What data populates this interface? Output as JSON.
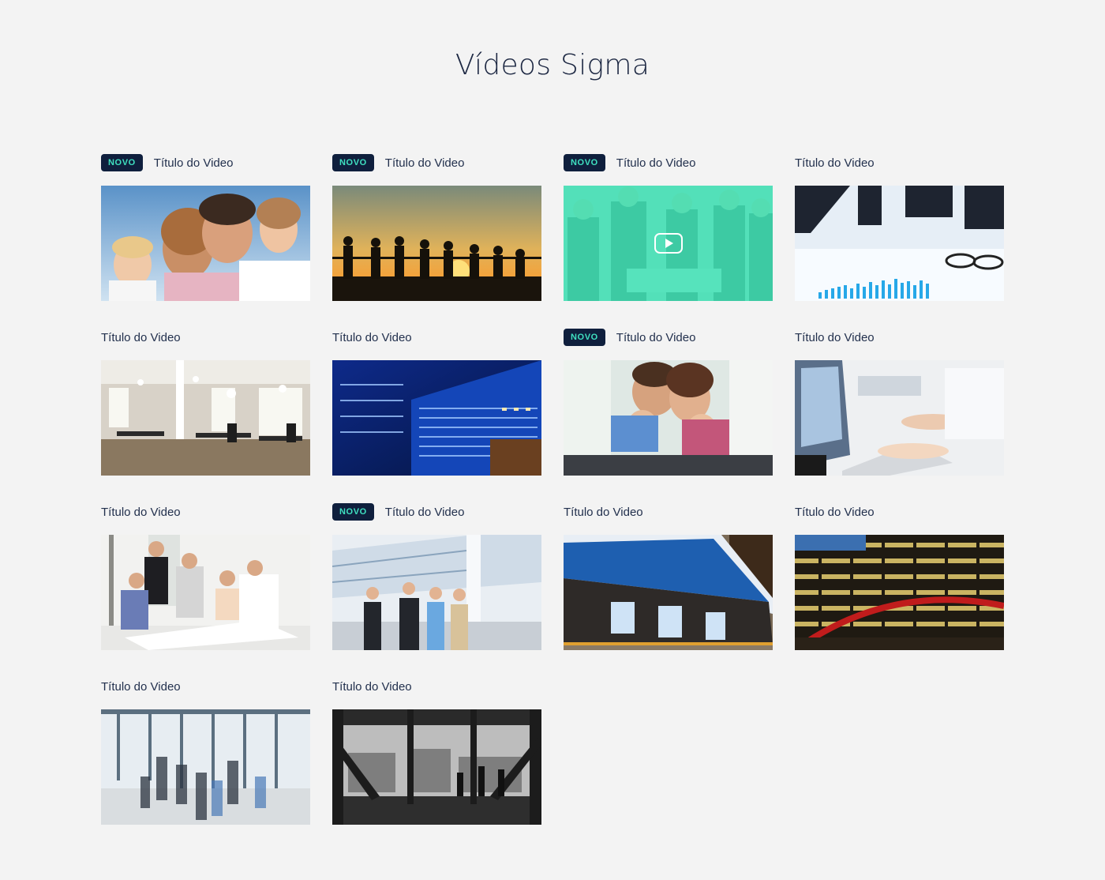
{
  "page": {
    "title": "Vídeos Sigma"
  },
  "badge_label": "NOVO",
  "colors": {
    "background": "#f3f3f3",
    "badge_bg": "#0f1f3d",
    "badge_text": "#3fe0c0",
    "hover_overlay": "#40e0b4",
    "title_text": "#1c2742"
  },
  "videos": [
    {
      "title": "Título do Video",
      "is_new": true,
      "hovered": false,
      "thumbnail": "family-portrait-sky"
    },
    {
      "title": "Título do Video",
      "is_new": true,
      "hovered": false,
      "thumbnail": "people-silhouettes-sunset"
    },
    {
      "title": "Título do Video",
      "is_new": true,
      "hovered": true,
      "thumbnail": "business-team-meeting"
    },
    {
      "title": "Título do Video",
      "is_new": false,
      "hovered": false,
      "thumbnail": "business-charts-glasses"
    },
    {
      "title": "Título do Video",
      "is_new": false,
      "hovered": false,
      "thumbnail": "open-office-interior"
    },
    {
      "title": "Título do Video",
      "is_new": false,
      "hovered": false,
      "thumbnail": "blue-glass-building"
    },
    {
      "title": "Título do Video",
      "is_new": true,
      "hovered": false,
      "thumbnail": "family-on-sofa"
    },
    {
      "title": "Título do Video",
      "is_new": false,
      "hovered": false,
      "thumbnail": "hands-typing-keyboard"
    },
    {
      "title": "Título do Video",
      "is_new": false,
      "hovered": false,
      "thumbnail": "team-working-table"
    },
    {
      "title": "Título do Video",
      "is_new": true,
      "hovered": false,
      "thumbnail": "business-people-atrium"
    },
    {
      "title": "Título do Video",
      "is_new": false,
      "hovered": false,
      "thumbnail": "bank-branch-facade"
    },
    {
      "title": "Título do Video",
      "is_new": false,
      "hovered": false,
      "thumbnail": "building-night-lights"
    },
    {
      "title": "Título do Video",
      "is_new": false,
      "hovered": false,
      "thumbnail": "busy-lobby-motion"
    },
    {
      "title": "Título do Video",
      "is_new": false,
      "hovered": false,
      "thumbnail": "city-view-window-bw"
    }
  ]
}
